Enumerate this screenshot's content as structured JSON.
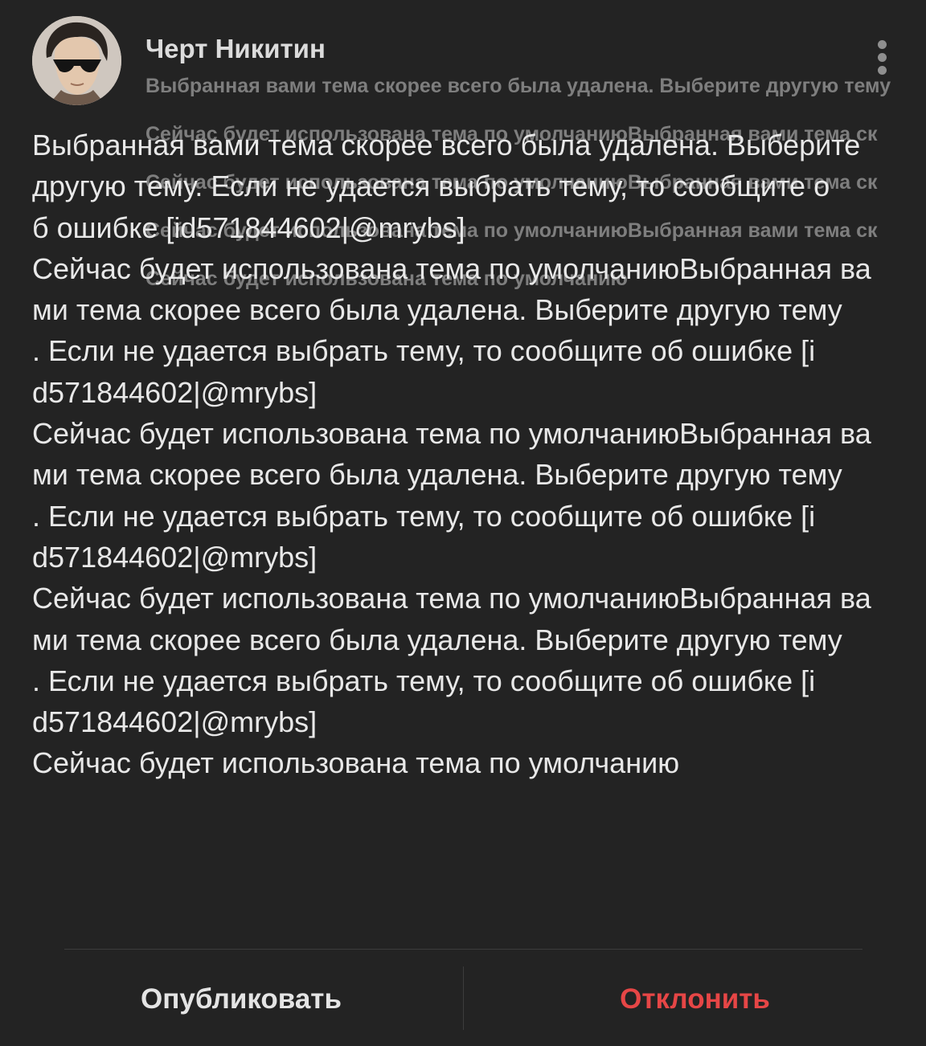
{
  "header": {
    "author_name": "Черт Никитин",
    "preview_lines": [
      "Выбранная вами тема скорее всего была удалена. Выберите другую тему",
      "Сейчас будет использована тема по умолчаниюВыбранная вами тема ск",
      "Сейчас будет использована тема по умолчаниюВыбранная вами тема ск",
      "Сейчас будет использована тема по умолчаниюВыбранная вами тема ск",
      "Сейчас будет использована тема по умолчанию"
    ],
    "menu_icon": "more-vertical-icon"
  },
  "post": {
    "lines": [
      "Выбранная вами тема скорее всего была удалена. Выберите",
      "другую тему. Если не удается выбрать тему, то сообщите о",
      "б ошибке [id571844602|@mrybs]",
      "Сейчас будет использована тема по умолчаниюВыбранная ва",
      "ми тема скорее всего была удалена. Выберите другую тему",
      ". Если не удается выбрать тему, то сообщите об ошибке [i",
      "d571844602|@mrybs]",
      "Сейчас будет использована тема по умолчаниюВыбранная ва",
      "ми тема скорее всего была удалена. Выберите другую тему",
      ". Если не удается выбрать тему, то сообщите об ошибке [i",
      "d571844602|@mrybs]",
      "Сейчас будет использована тема по умолчаниюВыбранная ва",
      "ми тема скорее всего была удалена. Выберите другую тему",
      ". Если не удается выбрать тему, то сообщите об ошибке [i",
      "d571844602|@mrybs]",
      "Сейчас будет использована тема по умолчанию"
    ]
  },
  "actions": {
    "publish_label": "Опубликовать",
    "reject_label": "Отклонить"
  },
  "colors": {
    "background": "#232323",
    "reject": "#e64646",
    "divider": "#3c3c3c"
  }
}
